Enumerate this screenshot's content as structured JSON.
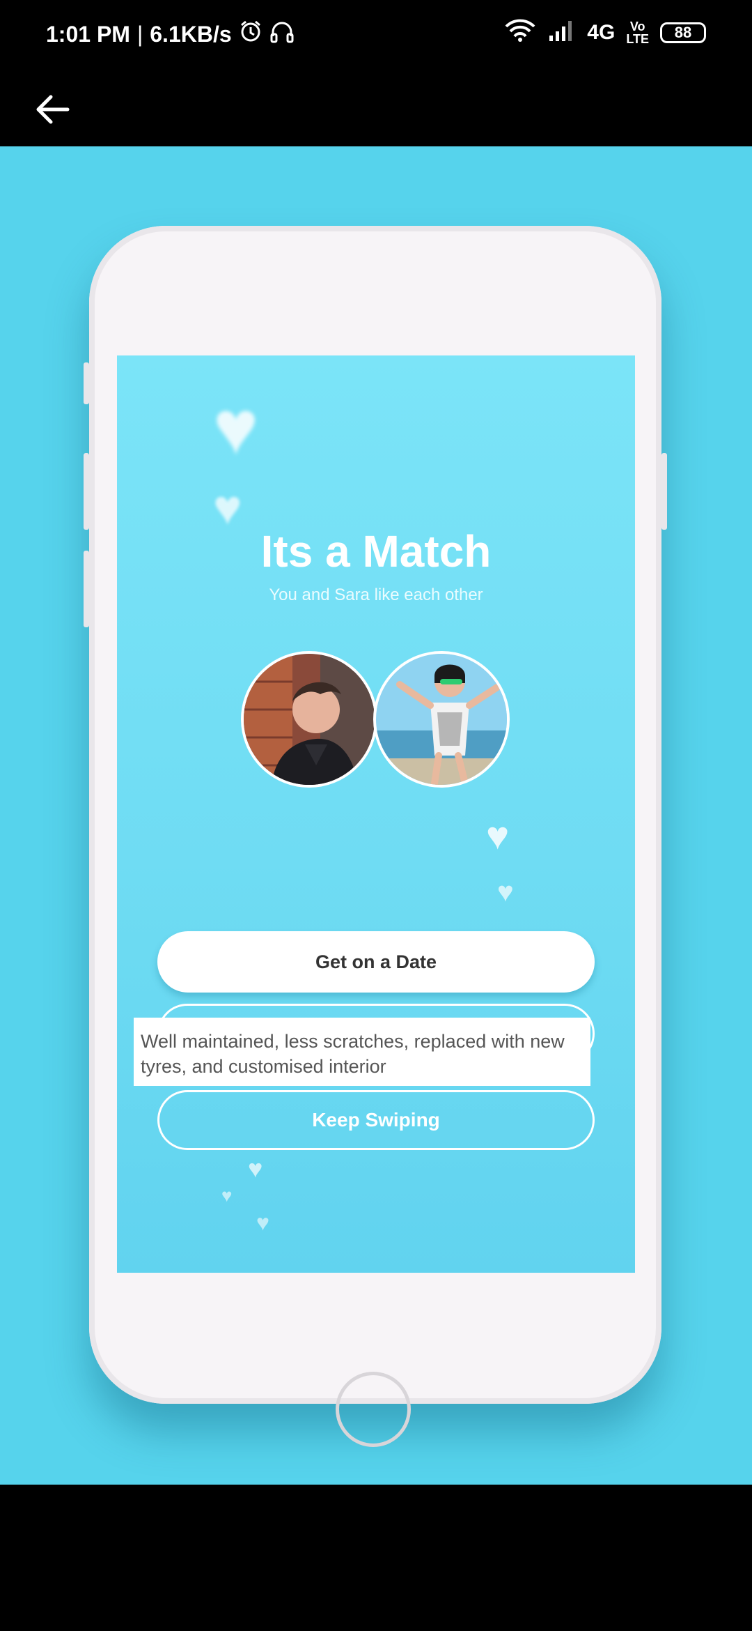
{
  "status_bar": {
    "time": "1:01 PM",
    "separator": "|",
    "speed": "6.1KB/s",
    "network": "4G",
    "volte_top": "Vo",
    "volte_bottom": "LTE",
    "battery": "88",
    "icons": [
      "alarm-icon",
      "headset-icon",
      "wifi-icon",
      "signal-icon"
    ]
  },
  "app_bar": {
    "back_icon": "arrow-left-icon"
  },
  "screen": {
    "title": "Its a Match",
    "subtitle": "You and Sara like each other",
    "primary_button": "Get on a Date",
    "overlay_text": "Well maintained, less scratches, replaced with new tyres, and customised interior",
    "secondary_button": "Keep Swiping"
  },
  "colors": {
    "background": "#56d3ec",
    "screen": "#6fdcf3",
    "phone_body": "#f7f4f7"
  }
}
